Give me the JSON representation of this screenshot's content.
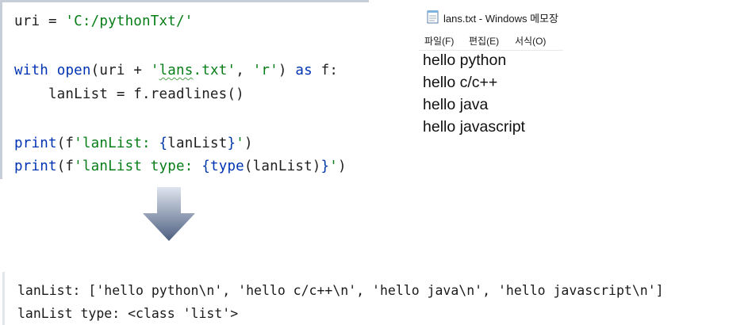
{
  "code_editor": {
    "line1": {
      "var": "uri = ",
      "str": "'C:/pythonTxt/'"
    },
    "line2": {
      "kw_with": "with",
      "sp1": " ",
      "fn_open": "open",
      "p1": "(uri + ",
      "str_file_pre": "'",
      "str_file_mid": "lans",
      "str_file_post": ".txt'",
      "p2": ", ",
      "str_mode": "'r'",
      "p3": ") ",
      "kw_as": "as",
      "p4": " f:"
    },
    "line3": {
      "text": "    lanList = f.readlines()"
    },
    "line4": {
      "fn": "print",
      "p1": "(f",
      "s1": "'lanList: ",
      "b1": "{",
      "v": "lanList",
      "b2": "}",
      "s2": "'",
      "p2": ")"
    },
    "line5": {
      "fn": "print",
      "p1": "(f",
      "s1": "'lanList type: ",
      "b1": "{",
      "fn_type": "type",
      "v": "(lanList)",
      "b2": "}",
      "s2": "'",
      "p2": ")"
    }
  },
  "notepad": {
    "title": "lans.txt - Windows 메모장",
    "menu": [
      "파일(F)",
      "편집(E)",
      "서식(O)"
    ],
    "lines": [
      "hello python",
      "hello c/c++",
      "hello java",
      "hello javascript"
    ]
  },
  "output": {
    "line1": "lanList: ['hello python\\n', 'hello c/c++\\n', 'hello java\\n', 'hello javascript\\n']",
    "line2": "lanList type: <class 'list'>"
  },
  "colors": {
    "keyword": "#0033b3",
    "string": "#067d17",
    "arrow_top": "#c9d2e3",
    "arrow_bottom": "#4d5f80"
  }
}
